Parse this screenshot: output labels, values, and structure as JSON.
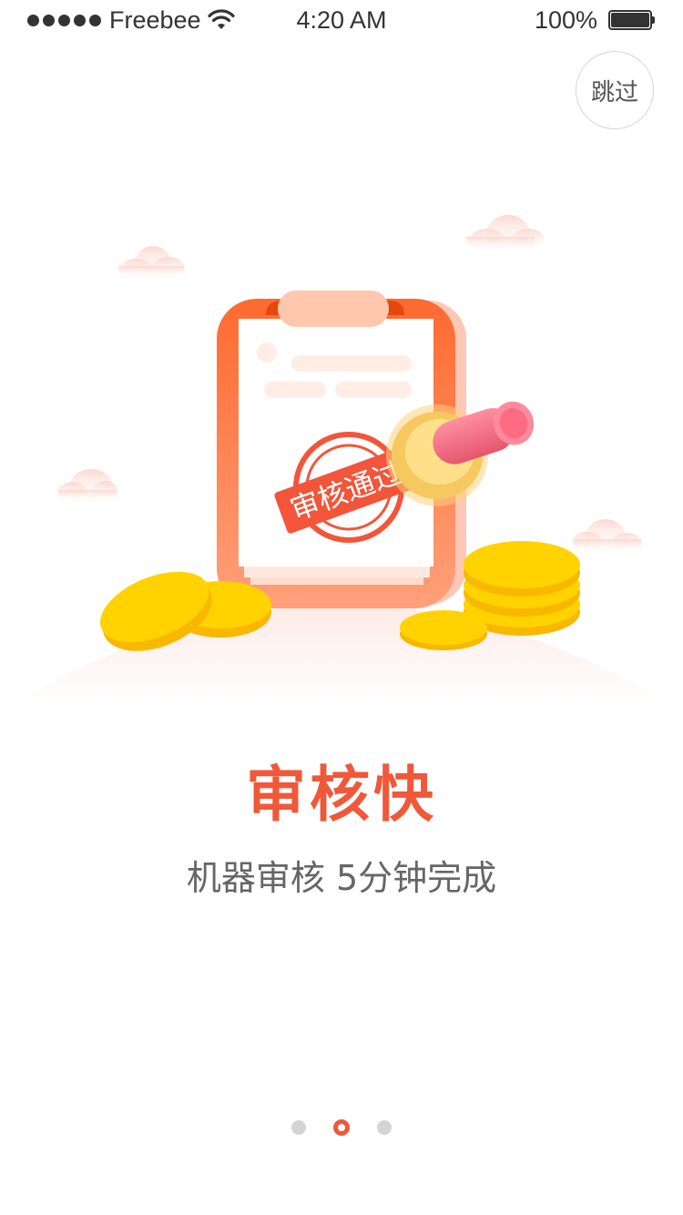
{
  "status_bar": {
    "carrier": "Freebee",
    "time": "4:20 AM",
    "battery": "100%",
    "battery_level": 1.0
  },
  "skip_button": {
    "label": "跳过"
  },
  "illustration": {
    "stamp_text": "审核通过",
    "colors": {
      "clipboard": "#ff6a3d",
      "coin": "#ffc300",
      "stamp_handle": "#f06a80"
    }
  },
  "onboarding": {
    "title": "审核快",
    "subtitle": "机器审核  5分钟完成"
  },
  "pager": {
    "total": 3,
    "active_index": 1
  },
  "colors": {
    "accent": "#f0583a",
    "subtitle": "#666666",
    "inactive_dot": "#d4d4d4"
  }
}
